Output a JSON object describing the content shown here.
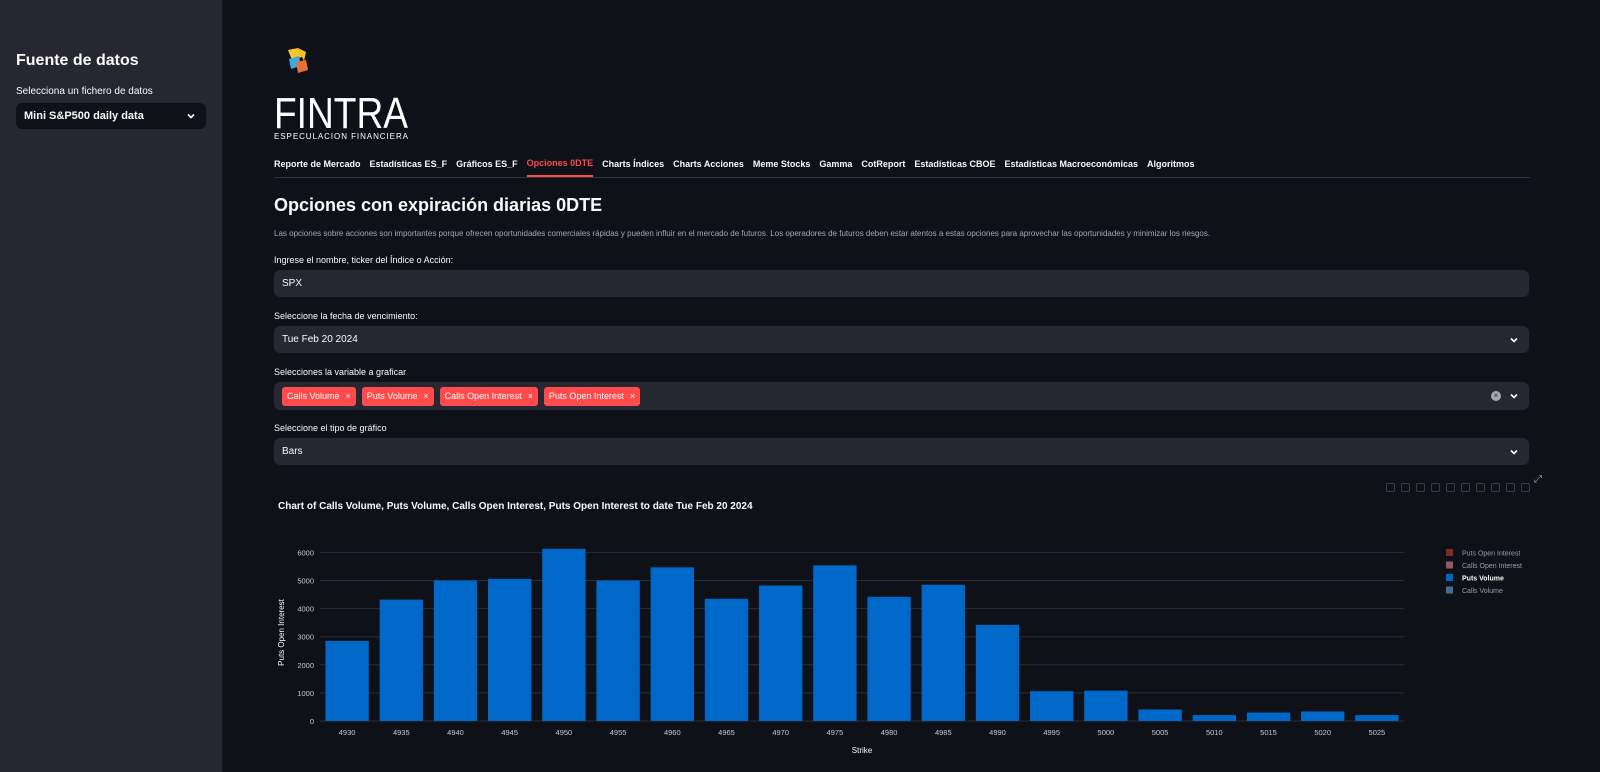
{
  "sidebar": {
    "title": "Fuente de datos",
    "select_label": "Selecciona un fichero de datos",
    "select_value": "Mini S&P500 daily data"
  },
  "logo": {
    "text": "FINTRA",
    "tagline": "ESPECULACION FINANCIERA"
  },
  "nav": {
    "tabs": [
      "Reporte de Mercado",
      "Estadísticas ES_F",
      "Gráficos ES_F",
      "Opciones 0DTE",
      "Charts Índices",
      "Charts Acciones",
      "Meme Stocks",
      "Gamma",
      "CotReport",
      "Estadísticas CBOE",
      "Estadísticas Macroeconómicas",
      "Algoritmos"
    ],
    "active_index": 3
  },
  "page": {
    "title": "Opciones con expiración diarias 0DTE",
    "description": "Las opciones sobre acciones son importantes porque ofrecen oportunidades comerciales rápidas y pueden influir en el mercado de futuros. Los operadores de futuros deben estar atentos a estas opciones para aprovechar las oportunidades y minimizar los riesgos."
  },
  "form": {
    "ticker_label": "Ingrese el nombre, ticker del Índice o Acción:",
    "ticker_value": "SPX",
    "date_label": "Seleccione la fecha de vencimiento:",
    "date_value": "Tue Feb 20 2024",
    "variable_label": "Selecciones la variable a graficar",
    "variables": [
      "Calls Volume",
      "Puts Volume",
      "Calls Open Interest",
      "Puts Open Interest"
    ],
    "chart_type_label": "Seleccione el tipo de gráfico",
    "chart_type_value": "Bars"
  },
  "colors": {
    "accent": "#ff4b4b",
    "bar": "#0068c9"
  },
  "chart_data": {
    "type": "bar",
    "title": "Chart of Calls Volume, Puts Volume, Calls Open Interest, Puts Open Interest to date Tue Feb 20 2024",
    "xlabel": "Strike",
    "ylabel": "Puts Open Interest",
    "categories": [
      "4930",
      "4935",
      "4940",
      "4945",
      "4950",
      "4955",
      "4960",
      "4965",
      "4970",
      "4975",
      "4980",
      "4985",
      "4990",
      "4995",
      "5000",
      "5005",
      "5010",
      "5015",
      "5020",
      "5025"
    ],
    "values": [
      2850,
      4320,
      5000,
      5060,
      6130,
      5000,
      5470,
      4350,
      4820,
      5540,
      4420,
      4850,
      3420,
      1060,
      1080,
      410,
      210,
      300,
      340,
      210
    ],
    "yticks": [
      0,
      1000,
      2000,
      3000,
      4000,
      5000,
      6000
    ],
    "ylim": [
      0,
      6300
    ],
    "grid": true,
    "legend_position": "right",
    "legend": [
      {
        "name": "Puts Open Interest",
        "color": "#83272a",
        "active": false
      },
      {
        "name": "Calls Open Interest",
        "color": "#8b5d63",
        "active": false
      },
      {
        "name": "Puts Volume",
        "color": "#0068c9",
        "active": true
      },
      {
        "name": "Calls Volume",
        "color": "#4a6a8f",
        "active": false
      }
    ]
  }
}
